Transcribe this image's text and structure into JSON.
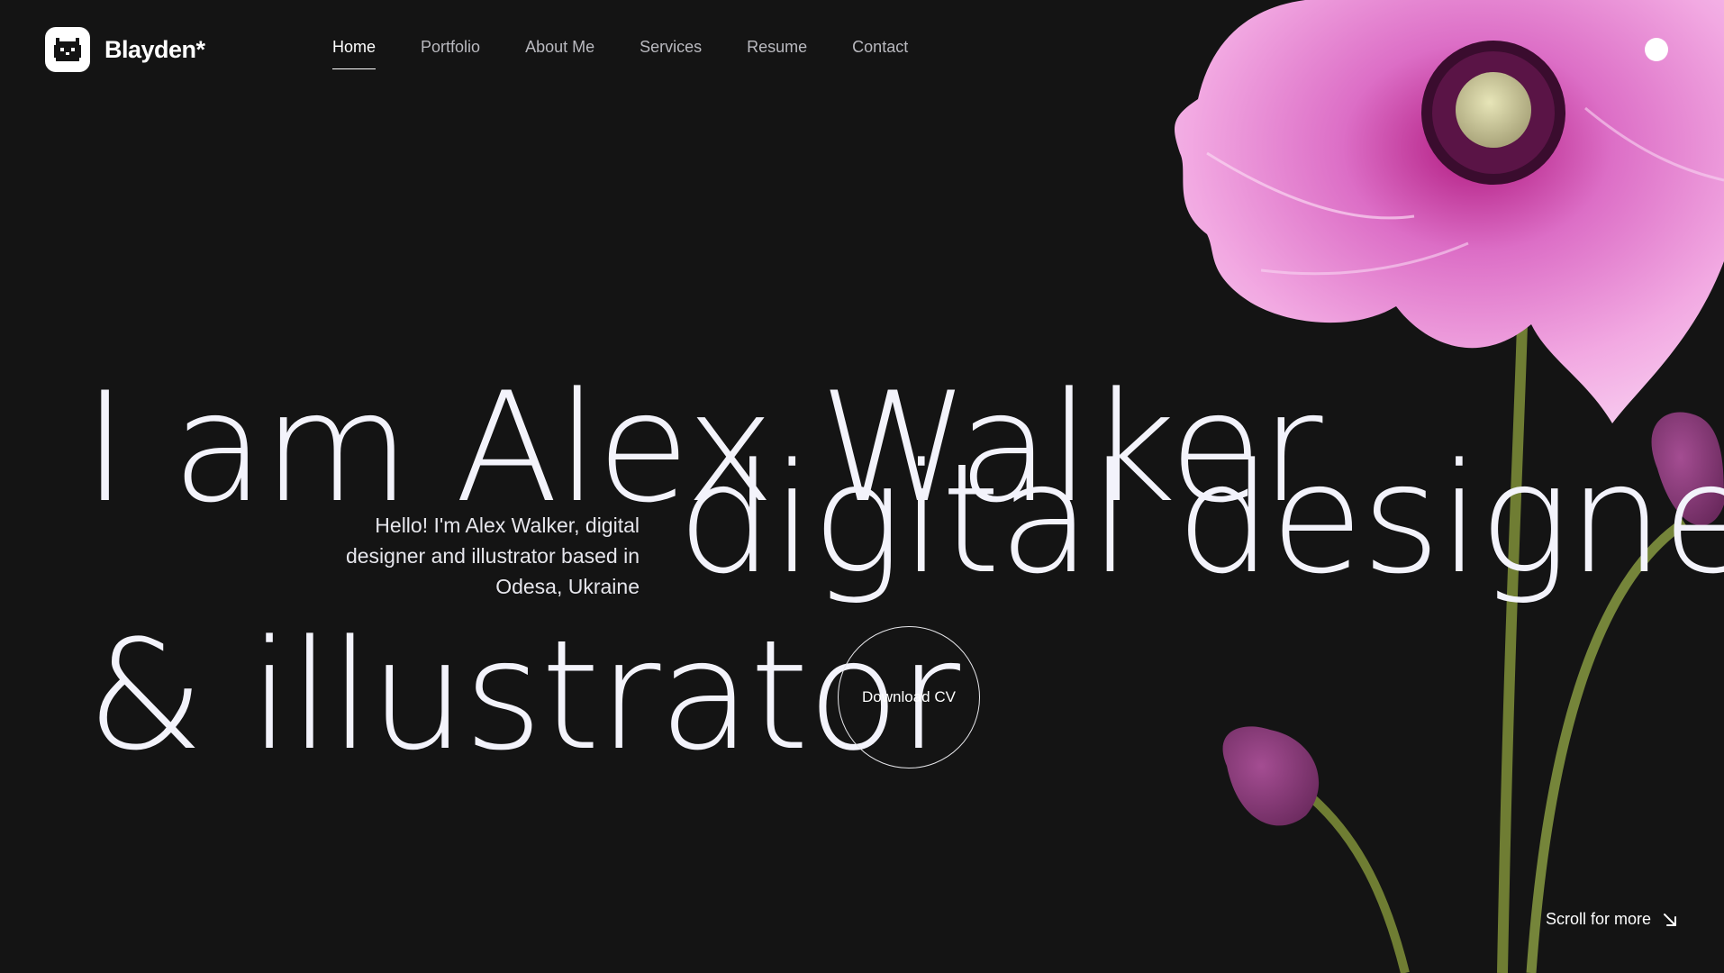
{
  "brand": {
    "name": "Blayden*",
    "logo_icon": "pixel-cat-icon"
  },
  "nav": {
    "items": [
      {
        "label": "Home",
        "active": true
      },
      {
        "label": "Portfolio",
        "active": false
      },
      {
        "label": "About Me",
        "active": false
      },
      {
        "label": "Services",
        "active": false
      },
      {
        "label": "Resume",
        "active": false
      },
      {
        "label": "Contact",
        "active": false
      }
    ],
    "menu_icon": "menu-dot-icon"
  },
  "hero": {
    "line1": "I am Alex Walker",
    "line2": "digital designer",
    "line3": "& illustrator",
    "intro": "Hello! I'm Alex Walker, digital designer and illustrator based in Odesa, Ukraine",
    "cta_label": "Download CV"
  },
  "scroll": {
    "label": "Scroll for more",
    "icon": "arrow-down-right-icon"
  },
  "colors": {
    "background": "#141414",
    "text": "#f3f3fb",
    "flower_pink": "#e27fd0",
    "stem_green": "#7a8a3c"
  }
}
